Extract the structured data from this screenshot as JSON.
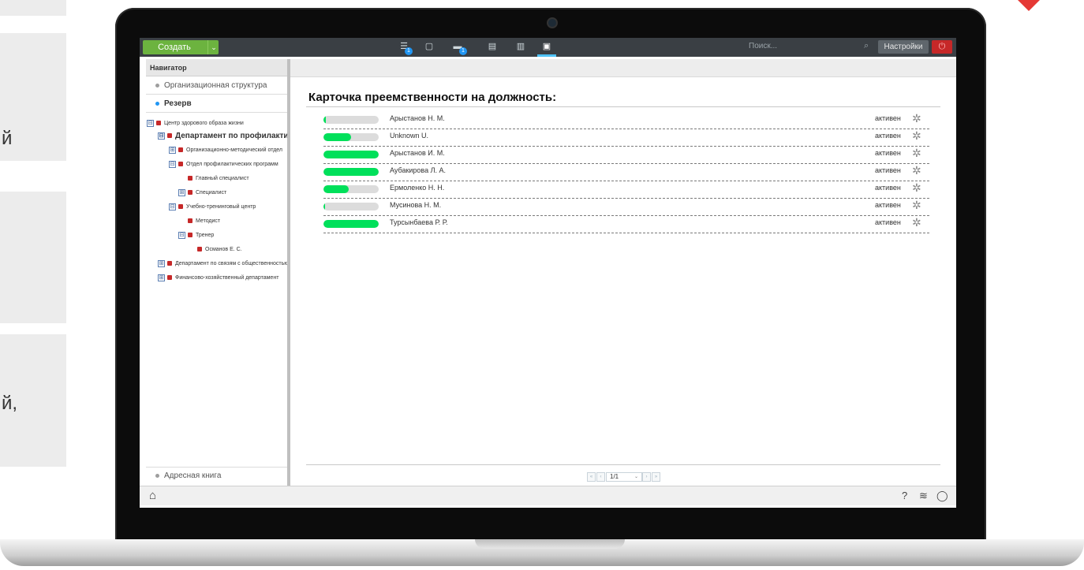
{
  "background": {
    "side_fragments": [
      "й",
      "й,"
    ]
  },
  "topbar": {
    "create_label": "Создать",
    "create_dropdown_glyph": "⌄",
    "icons": [
      {
        "name": "list-icon",
        "glyph": "☰",
        "badge": "1"
      },
      {
        "name": "calendar-icon",
        "glyph": "▢",
        "badge": ""
      },
      {
        "name": "folder-icon",
        "glyph": "▬",
        "badge": "1"
      },
      {
        "name": "document-icon",
        "glyph": "▤",
        "badge": ""
      },
      {
        "name": "chart-icon",
        "glyph": "▥",
        "badge": ""
      },
      {
        "name": "id-card-icon",
        "glyph": "▣",
        "badge": ""
      }
    ],
    "search_placeholder": "Поиск...",
    "search_icon": "⌕",
    "settings_label": "Настройки",
    "power_glyph": "⏻"
  },
  "sidebar": {
    "header": "Навигатор",
    "sections": [
      {
        "label": "Организационная структура",
        "active": false
      },
      {
        "label": "Резерв",
        "active": true
      }
    ],
    "tree": [
      {
        "label": "Центр здорового образа жизни",
        "toggle": "⊟",
        "bold": false
      },
      {
        "label": "Департамент по профилактике",
        "toggle": "⊟",
        "bold": true
      },
      {
        "label": "Организационно-методический отдел",
        "toggle": "⊞",
        "bold": false
      },
      {
        "label": "Отдел профилактических программ",
        "toggle": "⊟",
        "bold": false
      },
      {
        "label": "Главный специалист",
        "toggle": "",
        "bold": false
      },
      {
        "label": "Специалист",
        "toggle": "⊞",
        "bold": false
      },
      {
        "label": "Учебно-тренинговый центр",
        "toggle": "⊟",
        "bold": false
      },
      {
        "label": "Методист",
        "toggle": "",
        "bold": false
      },
      {
        "label": "Тренер",
        "toggle": "⊟",
        "bold": false
      },
      {
        "label": "Османов Е. С.",
        "toggle": "",
        "bold": false
      },
      {
        "label": "Департамент по связям с общественностью",
        "toggle": "⊞",
        "bold": false
      },
      {
        "label": "Финансово-хозяйственный департамент",
        "toggle": "⊞",
        "bold": false
      }
    ],
    "bottom_section": "Адресная книга"
  },
  "main": {
    "title": "Карточка преемственности на должность:",
    "progress_color": "#00e05a",
    "rows": [
      {
        "name": "Арыстанов Н. М.",
        "status": "активен",
        "progress": 0.04
      },
      {
        "name": "Unknown U.",
        "status": "активен",
        "progress": 0.5
      },
      {
        "name": "Арыстанов И. М.",
        "status": "активен",
        "progress": 1.0
      },
      {
        "name": "Аубакирова Л. А.",
        "status": "активен",
        "progress": 1.0
      },
      {
        "name": "Ермоленко Н. Н.",
        "status": "активен",
        "progress": 0.45
      },
      {
        "name": "Мусинова Н. М.",
        "status": "активен",
        "progress": 0.03
      },
      {
        "name": "Турсынбаева Р. Р.",
        "status": "активен",
        "progress": 1.0
      }
    ],
    "gear_glyph": "✲"
  },
  "pager": {
    "first": "«",
    "prev": "‹",
    "page": "1/1",
    "caret": "⌄",
    "next": "›",
    "last": "»"
  },
  "statusbar": {
    "home_glyph": "⌂",
    "help_glyph": "?",
    "wifi_glyph": "≋",
    "chat_glyph": "◯"
  }
}
